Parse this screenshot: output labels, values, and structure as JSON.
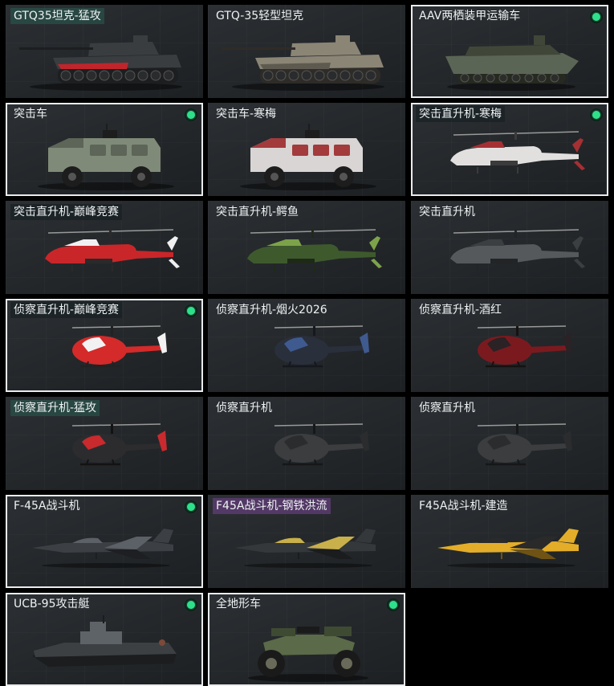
{
  "vehicles": [
    {
      "label": "GTQ35坦克-猛攻",
      "kind": "tank",
      "selected": false,
      "equipped": false,
      "tag": "teal",
      "colors": {
        "body": "#3a3d40",
        "accent": "#c0252c",
        "trim": "#1c1e20"
      }
    },
    {
      "label": "GTQ-35轻型坦克",
      "kind": "tank",
      "selected": false,
      "equipped": false,
      "tag": "none",
      "colors": {
        "body": "#8b8576",
        "accent": "#5f5a4f",
        "trim": "#2e2c28"
      }
    },
    {
      "label": "AAV两栖装甲运输车",
      "kind": "aav",
      "selected": true,
      "equipped": true,
      "tag": "none",
      "colors": {
        "body": "#5b6556",
        "accent": "#404739",
        "trim": "#26291f"
      }
    },
    {
      "label": "突击车",
      "kind": "truck",
      "selected": true,
      "equipped": true,
      "tag": "none",
      "colors": {
        "body": "#7f8a78",
        "accent": "#5c6557",
        "trim": "#1c1d1c"
      }
    },
    {
      "label": "突击车-寒梅",
      "kind": "truck",
      "selected": false,
      "equipped": false,
      "tag": "none",
      "colors": {
        "body": "#d8d5d4",
        "accent": "#a33a3c",
        "trim": "#1c1d1c"
      }
    },
    {
      "label": "突击直升机-寒梅",
      "kind": "attack-heli",
      "selected": true,
      "equipped": true,
      "tag": "dark",
      "colors": {
        "body": "#e2e0df",
        "accent": "#a53034",
        "trim": "#3b3b3b"
      }
    },
    {
      "label": "突击直升机-巅峰竞赛",
      "kind": "attack-heli",
      "selected": false,
      "equipped": false,
      "tag": "dark",
      "colors": {
        "body": "#c9262a",
        "accent": "#f0f0f0",
        "trim": "#2a2a2a"
      }
    },
    {
      "label": "突击直升机-鳄鱼",
      "kind": "attack-heli",
      "selected": false,
      "equipped": false,
      "tag": "none",
      "colors": {
        "body": "#3e5a2d",
        "accent": "#7da34a",
        "trim": "#1e2a18"
      }
    },
    {
      "label": "突击直升机",
      "kind": "attack-heli",
      "selected": false,
      "equipped": false,
      "tag": "none",
      "colors": {
        "body": "#55595c",
        "accent": "#3c3f41",
        "trim": "#222426"
      }
    },
    {
      "label": "侦察直升机-巅峰竞赛",
      "kind": "scout-heli",
      "selected": true,
      "equipped": true,
      "tag": "dark",
      "colors": {
        "body": "#d42a2a",
        "accent": "#f2f2f2",
        "trim": "#222"
      }
    },
    {
      "label": "侦察直升机-烟火2026",
      "kind": "scout-heli",
      "selected": false,
      "equipped": false,
      "tag": "none",
      "colors": {
        "body": "#2a2f3c",
        "accent": "#3f5a8f",
        "trim": "#15181e"
      }
    },
    {
      "label": "侦察直升机-酒红",
      "kind": "scout-heli",
      "selected": false,
      "equipped": false,
      "tag": "none",
      "colors": {
        "body": "#7a1a1f",
        "accent": "#2a2224",
        "trim": "#151212"
      }
    },
    {
      "label": "侦察直升机-猛攻",
      "kind": "scout-heli",
      "selected": false,
      "equipped": false,
      "tag": "teal",
      "colors": {
        "body": "#2c2c2e",
        "accent": "#c82a2e",
        "trim": "#131314"
      }
    },
    {
      "label": "侦察直升机",
      "kind": "scout-heli",
      "selected": false,
      "equipped": false,
      "tag": "none",
      "colors": {
        "body": "#3b3d3f",
        "accent": "#2a2c2e",
        "trim": "#161718"
      }
    },
    {
      "label": "侦察直升机",
      "kind": "scout-heli",
      "selected": false,
      "equipped": false,
      "tag": "none",
      "colors": {
        "body": "#3b3d3f",
        "accent": "#2a2c2e",
        "trim": "#161718"
      }
    },
    {
      "label": "F-45A战斗机",
      "kind": "jet",
      "selected": true,
      "equipped": true,
      "tag": "none",
      "colors": {
        "body": "#3c4045",
        "accent": "#5c6167",
        "trim": "#1d1f22"
      }
    },
    {
      "label": "F45A战斗机-钢铁洪流",
      "kind": "jet",
      "selected": false,
      "equipped": false,
      "tag": "purple",
      "colors": {
        "body": "#34383a",
        "accent": "#c9b04a",
        "trim": "#1a1c1d"
      }
    },
    {
      "label": "F45A战斗机-建造",
      "kind": "jet",
      "selected": false,
      "equipped": false,
      "tag": "none",
      "colors": {
        "body": "#e3ad2a",
        "accent": "#2a2a2a",
        "trim": "#6e5314"
      }
    },
    {
      "label": "UCB-95攻击艇",
      "kind": "boat",
      "selected": true,
      "equipped": true,
      "tag": "none",
      "colors": {
        "body": "#3c4043",
        "accent": "#5e6367",
        "trim": "#1b1d1e"
      }
    },
    {
      "label": "全地形车",
      "kind": "atv",
      "selected": true,
      "equipped": true,
      "tag": "none",
      "colors": {
        "body": "#5b6a48",
        "accent": "#3f4a33",
        "trim": "#1a1a1a"
      }
    }
  ]
}
